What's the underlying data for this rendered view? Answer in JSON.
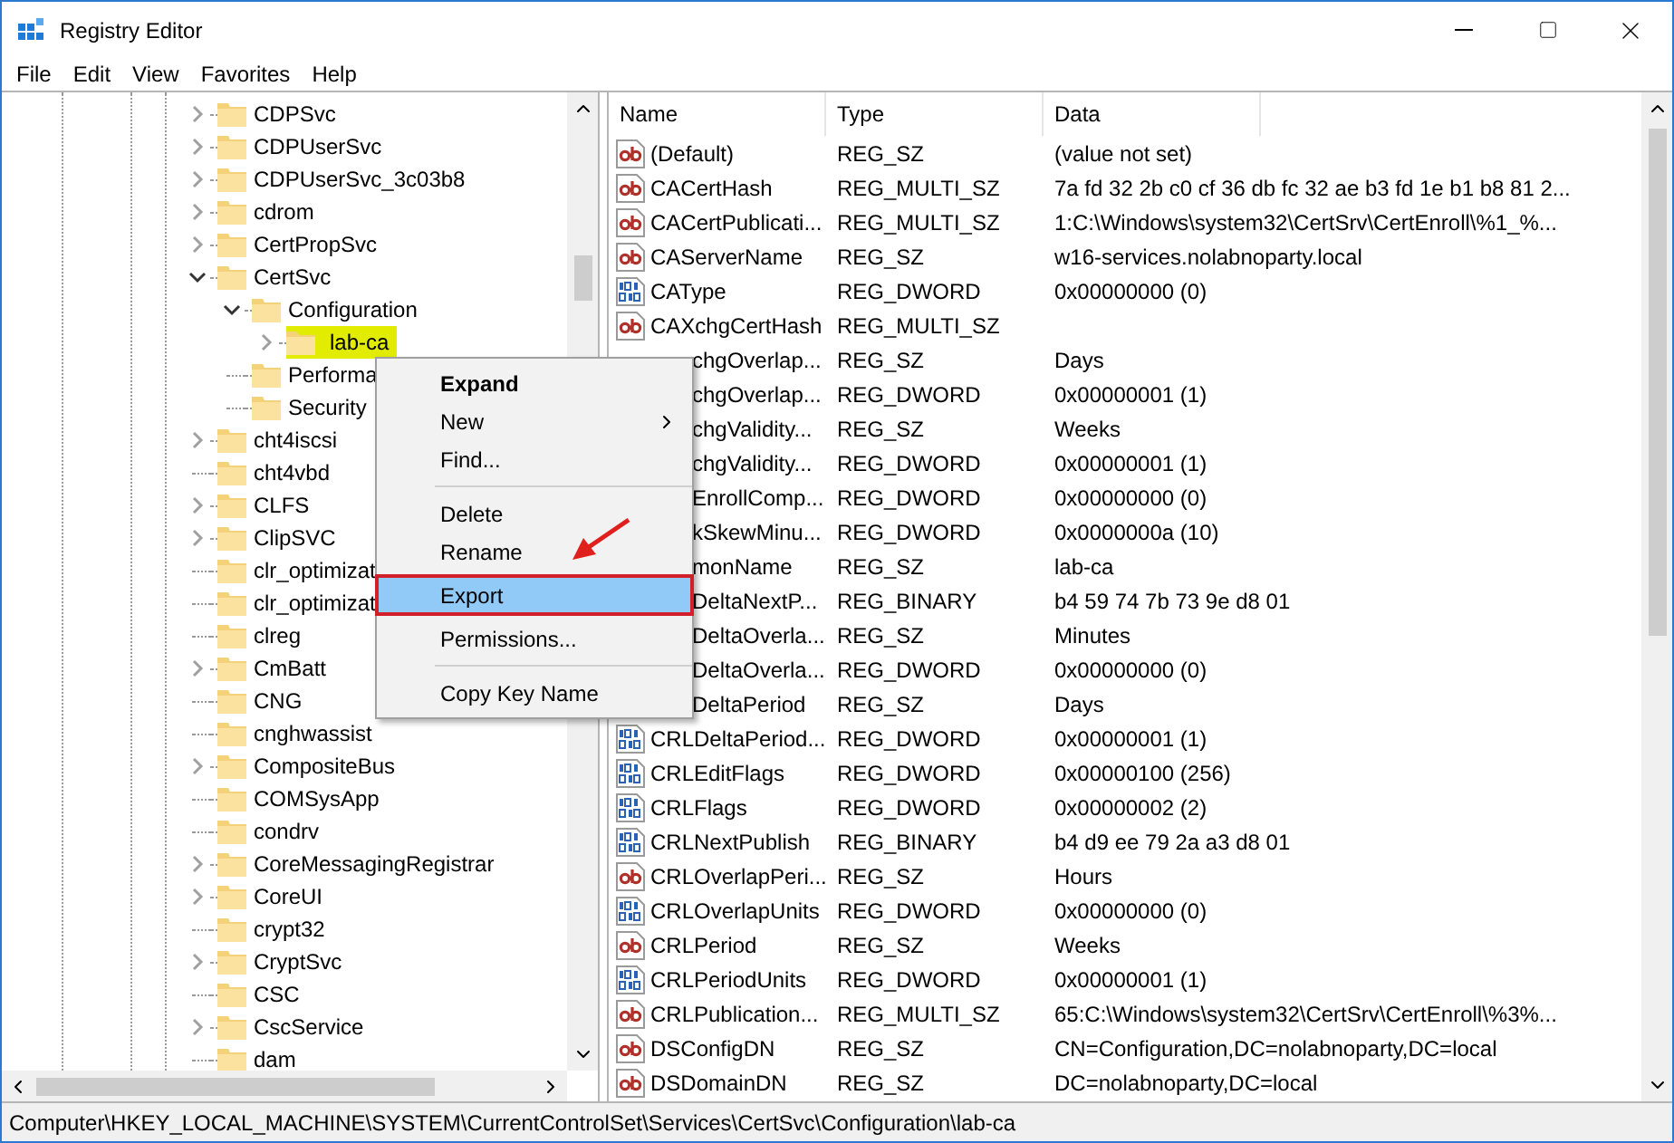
{
  "window": {
    "title": "Registry Editor"
  },
  "menu_bar": [
    "File",
    "Edit",
    "View",
    "Favorites",
    "Help"
  ],
  "tree": [
    {
      "label": "CDPSvc",
      "has_children": true,
      "expanded": false,
      "selected": false
    },
    {
      "label": "CDPUserSvc",
      "has_children": true,
      "expanded": false,
      "selected": false
    },
    {
      "label": "CDPUserSvc_3c03b8",
      "has_children": true,
      "expanded": false,
      "selected": false
    },
    {
      "label": "cdrom",
      "has_children": true,
      "expanded": false,
      "selected": false
    },
    {
      "label": "CertPropSvc",
      "has_children": true,
      "expanded": false,
      "selected": false
    },
    {
      "label": "CertSvc",
      "has_children": true,
      "expanded": true,
      "selected": false,
      "children": [
        {
          "label": "Configuration",
          "has_children": true,
          "expanded": true,
          "selected": false,
          "children": [
            {
              "label": "lab-ca",
              "has_children": true,
              "expanded": false,
              "selected": true
            }
          ]
        },
        {
          "label": "Performa",
          "has_children": false,
          "selected": false
        },
        {
          "label": "Security",
          "has_children": false,
          "selected": false
        }
      ]
    },
    {
      "label": "cht4iscsi",
      "has_children": true,
      "expanded": false,
      "selected": false
    },
    {
      "label": "cht4vbd",
      "has_children": false,
      "selected": false
    },
    {
      "label": "CLFS",
      "has_children": true,
      "expanded": false,
      "selected": false
    },
    {
      "label": "ClipSVC",
      "has_children": true,
      "expanded": false,
      "selected": false
    },
    {
      "label": "clr_optimizat",
      "has_children": false,
      "selected": false
    },
    {
      "label": "clr_optimizat",
      "has_children": false,
      "selected": false
    },
    {
      "label": "clreg",
      "has_children": false,
      "selected": false
    },
    {
      "label": "CmBatt",
      "has_children": true,
      "expanded": false,
      "selected": false
    },
    {
      "label": "CNG",
      "has_children": false,
      "selected": false
    },
    {
      "label": "cnghwassist",
      "has_children": false,
      "selected": false
    },
    {
      "label": "CompositeBus",
      "has_children": true,
      "expanded": false,
      "selected": false
    },
    {
      "label": "COMSysApp",
      "has_children": false,
      "selected": false
    },
    {
      "label": "condrv",
      "has_children": false,
      "selected": false
    },
    {
      "label": "CoreMessagingRegistrar",
      "has_children": true,
      "expanded": false,
      "selected": false
    },
    {
      "label": "CoreUI",
      "has_children": true,
      "expanded": false,
      "selected": false
    },
    {
      "label": "crypt32",
      "has_children": false,
      "selected": false
    },
    {
      "label": "CryptSvc",
      "has_children": true,
      "expanded": false,
      "selected": false
    },
    {
      "label": "CSC",
      "has_children": false,
      "selected": false
    },
    {
      "label": "CscService",
      "has_children": true,
      "expanded": false,
      "selected": false
    },
    {
      "label": "dam",
      "has_children": false,
      "selected": false
    }
  ],
  "values": {
    "columns": [
      "Name",
      "Type",
      "Data"
    ],
    "rows": [
      {
        "kind": "string",
        "name": "(Default)",
        "type": "REG_SZ",
        "data": "(value not set)"
      },
      {
        "kind": "string",
        "name": "CACertHash",
        "type": "REG_MULTI_SZ",
        "data": "7a fd 32 2b c0 cf 36 db fc 32 ae b3 fd 1e b1 b8 81 2..."
      },
      {
        "kind": "string",
        "name": "CACertPublicati...",
        "type": "REG_MULTI_SZ",
        "data": "1:C:\\Windows\\system32\\CertSrv\\CertEnroll\\%1_%..."
      },
      {
        "kind": "string",
        "name": "CAServerName",
        "type": "REG_SZ",
        "data": "w16-services.nolabnoparty.local"
      },
      {
        "kind": "binary",
        "name": "CAType",
        "type": "REG_DWORD",
        "data": "0x00000000 (0)"
      },
      {
        "kind": "string",
        "name": "CAXchgCertHash",
        "type": "REG_MULTI_SZ"
      },
      {
        "kind": "covered",
        "name": "chgOverlap...",
        "type": "REG_SZ",
        "data": "Days"
      },
      {
        "kind": "covered",
        "name": "chgOverlap...",
        "type": "REG_DWORD",
        "data": "0x00000001 (1)"
      },
      {
        "kind": "covered",
        "name": "chgValidity...",
        "type": "REG_SZ",
        "data": "Weeks"
      },
      {
        "kind": "covered",
        "name": "chgValidity...",
        "type": "REG_DWORD",
        "data": "0x00000001 (1)"
      },
      {
        "kind": "covered",
        "name": "EnrollComp...",
        "type": "REG_DWORD",
        "data": "0x00000000 (0)"
      },
      {
        "kind": "covered",
        "name": "kSkewMinu...",
        "type": "REG_DWORD",
        "data": "0x0000000a (10)"
      },
      {
        "kind": "covered",
        "name": "monName",
        "type": "REG_SZ",
        "data": "lab-ca"
      },
      {
        "kind": "covered",
        "name": "DeltaNextP...",
        "type": "REG_BINARY",
        "data": "b4 59 74 7b 73 9e d8 01"
      },
      {
        "kind": "covered",
        "name": "DeltaOverla...",
        "type": "REG_SZ",
        "data": "Minutes"
      },
      {
        "kind": "covered",
        "name": "DeltaOverla...",
        "type": "REG_DWORD",
        "data": "0x00000000 (0)"
      },
      {
        "kind": "covered",
        "name": "DeltaPeriod",
        "type": "REG_SZ",
        "data": "Days"
      },
      {
        "kind": "binary",
        "name": "CRLDeltaPeriod...",
        "type": "REG_DWORD",
        "data": "0x00000001 (1)"
      },
      {
        "kind": "binary",
        "name": "CRLEditFlags",
        "type": "REG_DWORD",
        "data": "0x00000100 (256)"
      },
      {
        "kind": "binary",
        "name": "CRLFlags",
        "type": "REG_DWORD",
        "data": "0x00000002 (2)"
      },
      {
        "kind": "binary",
        "name": "CRLNextPublish",
        "type": "REG_BINARY",
        "data": "b4 d9 ee 79 2a a3 d8 01"
      },
      {
        "kind": "string",
        "name": "CRLOverlapPeri...",
        "type": "REG_SZ",
        "data": "Hours"
      },
      {
        "kind": "binary",
        "name": "CRLOverlapUnits",
        "type": "REG_DWORD",
        "data": "0x00000000 (0)"
      },
      {
        "kind": "string",
        "name": "CRLPeriod",
        "type": "REG_SZ",
        "data": "Weeks"
      },
      {
        "kind": "binary",
        "name": "CRLPeriodUnits",
        "type": "REG_DWORD",
        "data": "0x00000001 (1)"
      },
      {
        "kind": "string",
        "name": "CRLPublication...",
        "type": "REG_MULTI_SZ",
        "data": "65:C:\\Windows\\system32\\CertSrv\\CertEnroll\\%3%..."
      },
      {
        "kind": "string",
        "name": "DSConfigDN",
        "type": "REG_SZ",
        "data": "CN=Configuration,DC=nolabnoparty,DC=local"
      },
      {
        "kind": "string",
        "name": "DSDomainDN",
        "type": "REG_SZ",
        "data": "DC=nolabnoparty,DC=local"
      }
    ]
  },
  "context_menu": [
    {
      "kind": "item",
      "label": "Expand",
      "default": true,
      "submenu": false,
      "selected": false
    },
    {
      "kind": "item",
      "label": "New",
      "default": false,
      "submenu": true,
      "selected": false
    },
    {
      "kind": "item",
      "label": "Find...",
      "default": false,
      "submenu": false,
      "selected": false
    },
    {
      "kind": "separator"
    },
    {
      "kind": "item",
      "label": "Delete",
      "default": false,
      "submenu": false,
      "selected": false
    },
    {
      "kind": "item",
      "label": "Rename",
      "default": false,
      "submenu": false,
      "selected": false
    },
    {
      "kind": "item",
      "label": "Export",
      "default": false,
      "submenu": false,
      "selected": true
    },
    {
      "kind": "item",
      "label": "Permissions...",
      "default": false,
      "submenu": false,
      "selected": false
    },
    {
      "kind": "separator"
    },
    {
      "kind": "item",
      "label": "Copy Key Name",
      "default": false,
      "submenu": false,
      "selected": false
    }
  ],
  "status_bar": "Computer\\HKEY_LOCAL_MACHINE\\SYSTEM\\CurrentControlSet\\Services\\CertSvc\\Configuration\\lab-ca"
}
